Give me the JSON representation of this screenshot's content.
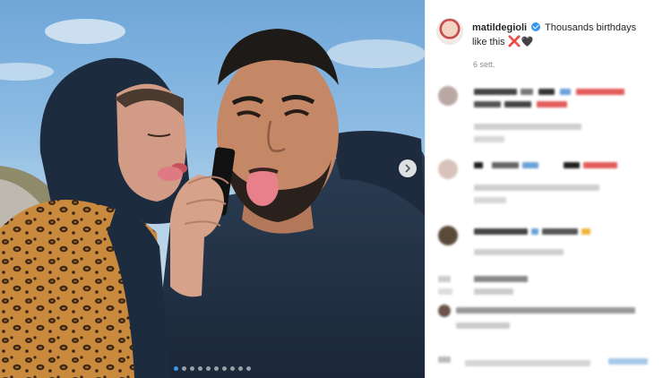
{
  "post": {
    "username": "matildegioli",
    "caption": "Thousands birthdays like this",
    "caption_emojis": [
      "❌",
      "🖤"
    ],
    "timestamp": "6 sett.",
    "verified": true
  },
  "carousel": {
    "total_slides": 10,
    "active_slide": 1,
    "next_icon": "chevron-right-icon"
  },
  "comments_note": "",
  "colors": {
    "link_blue": "#3897f0",
    "muted_text": "#8e8e8e",
    "border": "#efefef"
  }
}
